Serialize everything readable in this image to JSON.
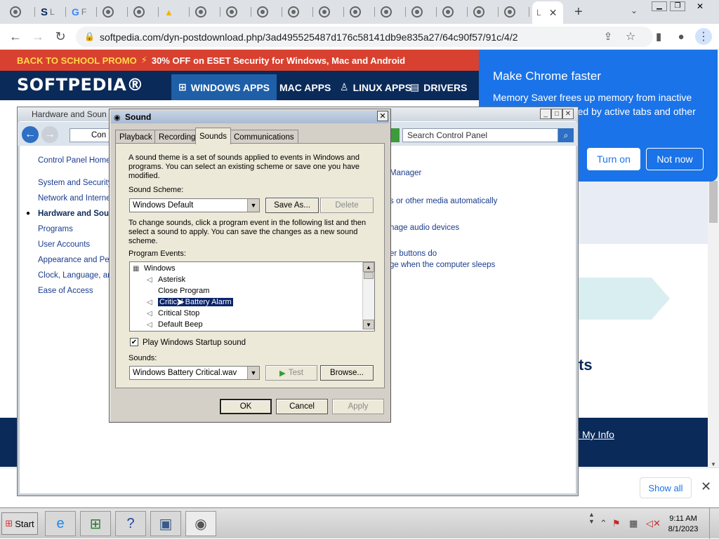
{
  "browser": {
    "tabs": [
      {
        "label": "",
        "icon": "chrome-icon"
      },
      {
        "label": "S",
        "icon": "softpedia-icon"
      },
      {
        "label": "G",
        "icon": "google-icon"
      },
      {
        "label": "",
        "icon": "chrome-icon"
      },
      {
        "label": "",
        "icon": "chrome-icon"
      },
      {
        "label": "",
        "icon": "drive-icon"
      },
      {
        "label": "",
        "icon": "chrome-icon"
      },
      {
        "label": "",
        "icon": "chrome-icon"
      },
      {
        "label": "",
        "icon": "chrome-icon"
      },
      {
        "label": "",
        "icon": "chrome-icon"
      },
      {
        "label": "",
        "icon": "chrome-icon"
      },
      {
        "label": "",
        "icon": "chrome-icon"
      },
      {
        "label": "",
        "icon": "chrome-icon"
      },
      {
        "label": "",
        "icon": "chrome-icon"
      },
      {
        "label": "",
        "icon": "chrome-icon"
      },
      {
        "label": "",
        "icon": "chrome-icon"
      },
      {
        "label": "",
        "icon": "chrome-icon"
      },
      {
        "label": "L",
        "icon": "chrome-icon",
        "active": true
      }
    ],
    "url": "softpedia.com/dyn-postdownload.php/3ad495525487d176c58141db9e835a27/64c90f57/91c/4/2"
  },
  "site": {
    "promo_prefix": "BACK TO SCHOOL PROMO",
    "promo_text": "30% OFF on ESET Security for Windows, Mac and Android",
    "logo": "SOFTPEDIA®",
    "nav": [
      "WINDOWS APPS",
      "MAC APPS",
      "LINUX APPS",
      "DRIVERS"
    ],
    "ts_fragment": "ts",
    "myinfo": "l My Info"
  },
  "chrome_popup": {
    "title": "Make Chrome faster",
    "body": "Memory Saver frees up memory from inactive tabs so it can be used by active tabs and other",
    "turn_on": "Turn on",
    "not_now": "Not now"
  },
  "download_bar": {
    "show_all": "Show all"
  },
  "control_panel": {
    "title": "Hardware and Soun",
    "address_crumb": "Con",
    "search_placeholder": "Search Control Panel",
    "left_links": [
      "Control Panel Home",
      "System and Security",
      "Network and Interne",
      "Hardware and Sou",
      "Programs",
      "User Accounts",
      "Appearance and Pers",
      "Clock, Language, and",
      "Ease of Access"
    ],
    "right_fragments": [
      "Manager",
      "s or other media automatically",
      "nage audio devices",
      "er buttons do",
      "ge when the computer sleeps"
    ]
  },
  "sound_dialog": {
    "title": "Sound",
    "tabs": [
      "Playback",
      "Recording",
      "Sounds",
      "Communications"
    ],
    "active_tab": "Sounds",
    "intro": "A sound theme is a set of sounds applied to events in Windows and programs.  You can select an existing scheme or save one you have modified.",
    "scheme_label": "Sound Scheme:",
    "scheme_value": "Windows Default",
    "save_as": "Save As...",
    "delete": "Delete",
    "instructions": "To change sounds, click a program event in the following list and then select a sound to apply.  You can save the changes as a new sound scheme.",
    "events_label": "Program Events:",
    "events": [
      {
        "label": "Windows",
        "group": true
      },
      {
        "label": "Asterisk",
        "has_sound": true
      },
      {
        "label": "Close Program",
        "has_sound": false
      },
      {
        "label": "Critical Battery Alarm",
        "has_sound": true,
        "selected": true
      },
      {
        "label": "Critical Stop",
        "has_sound": true
      },
      {
        "label": "Default Beep",
        "has_sound": true
      }
    ],
    "startup_label": "Play Windows Startup sound",
    "startup_checked": true,
    "sounds_label": "Sounds:",
    "sound_value": "Windows Battery Critical.wav",
    "test": "Test",
    "browse": "Browse...",
    "ok": "OK",
    "cancel": "Cancel",
    "apply": "Apply"
  },
  "taskbar": {
    "start": "Start",
    "time": "9:11 AM",
    "date": "8/1/2023"
  },
  "colors": {
    "promo_red": "#d8412f",
    "softpedia_navy": "#0a2a5a",
    "chrome_blue": "#1a73e8",
    "selection": "#0a246a"
  }
}
